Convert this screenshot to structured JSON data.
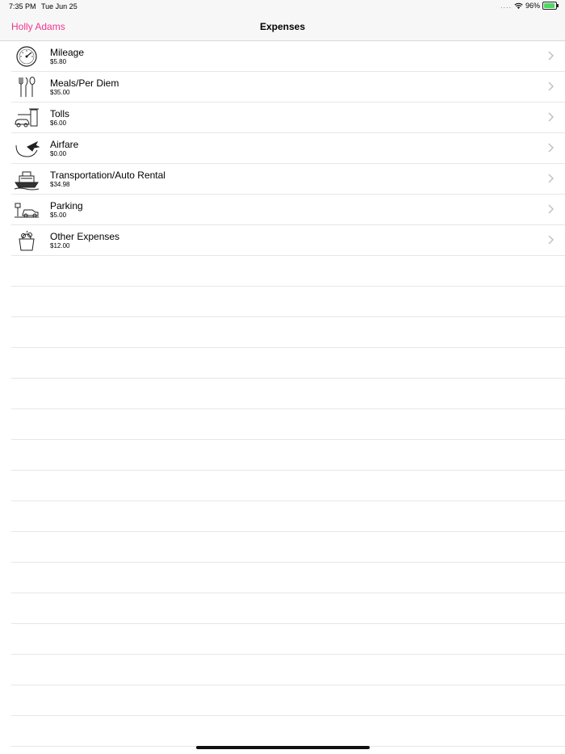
{
  "status": {
    "time": "7:35 PM",
    "date": "Tue Jun 25",
    "signal": "....",
    "battery_text": "96%",
    "battery_level": 0.96
  },
  "nav": {
    "back_label": "Holly Adams",
    "title": "Expenses"
  },
  "expenses": [
    {
      "label": "Mileage",
      "amount": "$5.80",
      "icon": "speedometer-icon"
    },
    {
      "label": "Meals/Per Diem",
      "amount": "$35.00",
      "icon": "utensils-icon"
    },
    {
      "label": "Tolls",
      "amount": "$6.00",
      "icon": "toll-booth-icon"
    },
    {
      "label": "Airfare",
      "amount": "$0.00",
      "icon": "airplane-icon"
    },
    {
      "label": "Transportation/Auto Rental",
      "amount": "$34.98",
      "icon": "ferry-icon"
    },
    {
      "label": "Parking",
      "amount": "$5.00",
      "icon": "parking-car-icon"
    },
    {
      "label": "Other Expenses",
      "amount": "$12.00",
      "icon": "shopping-bag-icon"
    }
  ],
  "colors": {
    "accent": "#f0348e",
    "separator": "#e6e6e6",
    "battery": "#4cd964"
  }
}
